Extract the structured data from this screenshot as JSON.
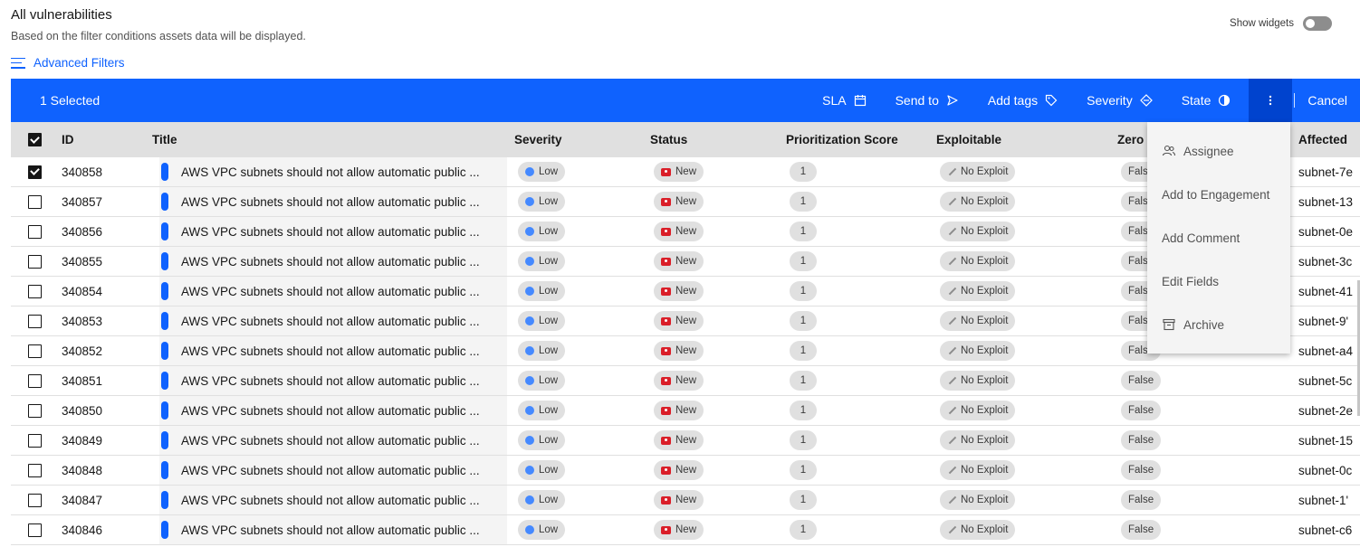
{
  "header": {
    "title": "All vulnerabilities",
    "subtitle": "Based on the filter conditions assets data will be displayed.",
    "advanced_filters": "Advanced Filters",
    "show_widgets": "Show widgets"
  },
  "action_bar": {
    "selected": "1 Selected",
    "sla": "SLA",
    "send_to": "Send to",
    "add_tags": "Add tags",
    "severity": "Severity",
    "state": "State",
    "cancel": "Cancel"
  },
  "columns": {
    "id": "ID",
    "title": "Title",
    "severity": "Severity",
    "status": "Status",
    "score": "Prioritization Score",
    "exploitable": "Exploitable",
    "zero": "Zero",
    "affected": "Affected"
  },
  "menu": {
    "items": [
      "Assignee",
      "Add to Engagement",
      "Add Comment",
      "Edit Fields",
      "Archive"
    ]
  },
  "rows": [
    {
      "id": "340858",
      "title": "AWS VPC subnets should not allow automatic public ...",
      "severity": "Low",
      "status": "New",
      "score": "1",
      "exploitable": "No Exploit",
      "zero": "False",
      "affected": "subnet-7e",
      "checked": true
    },
    {
      "id": "340857",
      "title": "AWS VPC subnets should not allow automatic public ...",
      "severity": "Low",
      "status": "New",
      "score": "1",
      "exploitable": "No Exploit",
      "zero": "False",
      "affected": "subnet-13",
      "checked": false
    },
    {
      "id": "340856",
      "title": "AWS VPC subnets should not allow automatic public ...",
      "severity": "Low",
      "status": "New",
      "score": "1",
      "exploitable": "No Exploit",
      "zero": "False",
      "affected": "subnet-0e",
      "checked": false
    },
    {
      "id": "340855",
      "title": "AWS VPC subnets should not allow automatic public ...",
      "severity": "Low",
      "status": "New",
      "score": "1",
      "exploitable": "No Exploit",
      "zero": "False",
      "affected": "subnet-3c",
      "checked": false
    },
    {
      "id": "340854",
      "title": "AWS VPC subnets should not allow automatic public ...",
      "severity": "Low",
      "status": "New",
      "score": "1",
      "exploitable": "No Exploit",
      "zero": "False",
      "affected": "subnet-41",
      "checked": false
    },
    {
      "id": "340853",
      "title": "AWS VPC subnets should not allow automatic public ...",
      "severity": "Low",
      "status": "New",
      "score": "1",
      "exploitable": "No Exploit",
      "zero": "False",
      "affected": "subnet-9'",
      "checked": false
    },
    {
      "id": "340852",
      "title": "AWS VPC subnets should not allow automatic public ...",
      "severity": "Low",
      "status": "New",
      "score": "1",
      "exploitable": "No Exploit",
      "zero": "False",
      "affected": "subnet-a4",
      "checked": false
    },
    {
      "id": "340851",
      "title": "AWS VPC subnets should not allow automatic public ...",
      "severity": "Low",
      "status": "New",
      "score": "1",
      "exploitable": "No Exploit",
      "zero": "False",
      "affected": "subnet-5c",
      "checked": false
    },
    {
      "id": "340850",
      "title": "AWS VPC subnets should not allow automatic public ...",
      "severity": "Low",
      "status": "New",
      "score": "1",
      "exploitable": "No Exploit",
      "zero": "False",
      "affected": "subnet-2e",
      "checked": false
    },
    {
      "id": "340849",
      "title": "AWS VPC subnets should not allow automatic public ...",
      "severity": "Low",
      "status": "New",
      "score": "1",
      "exploitable": "No Exploit",
      "zero": "False",
      "affected": "subnet-15",
      "checked": false
    },
    {
      "id": "340848",
      "title": "AWS VPC subnets should not allow automatic public ...",
      "severity": "Low",
      "status": "New",
      "score": "1",
      "exploitable": "No Exploit",
      "zero": "False",
      "affected": "subnet-0c",
      "checked": false
    },
    {
      "id": "340847",
      "title": "AWS VPC subnets should not allow automatic public ...",
      "severity": "Low",
      "status": "New",
      "score": "1",
      "exploitable": "No Exploit",
      "zero": "False",
      "affected": "subnet-1'",
      "checked": false
    },
    {
      "id": "340846",
      "title": "AWS VPC subnets should not allow automatic public ...",
      "severity": "Low",
      "status": "New",
      "score": "1",
      "exploitable": "No Exploit",
      "zero": "False",
      "affected": "subnet-c6",
      "checked": false
    }
  ]
}
